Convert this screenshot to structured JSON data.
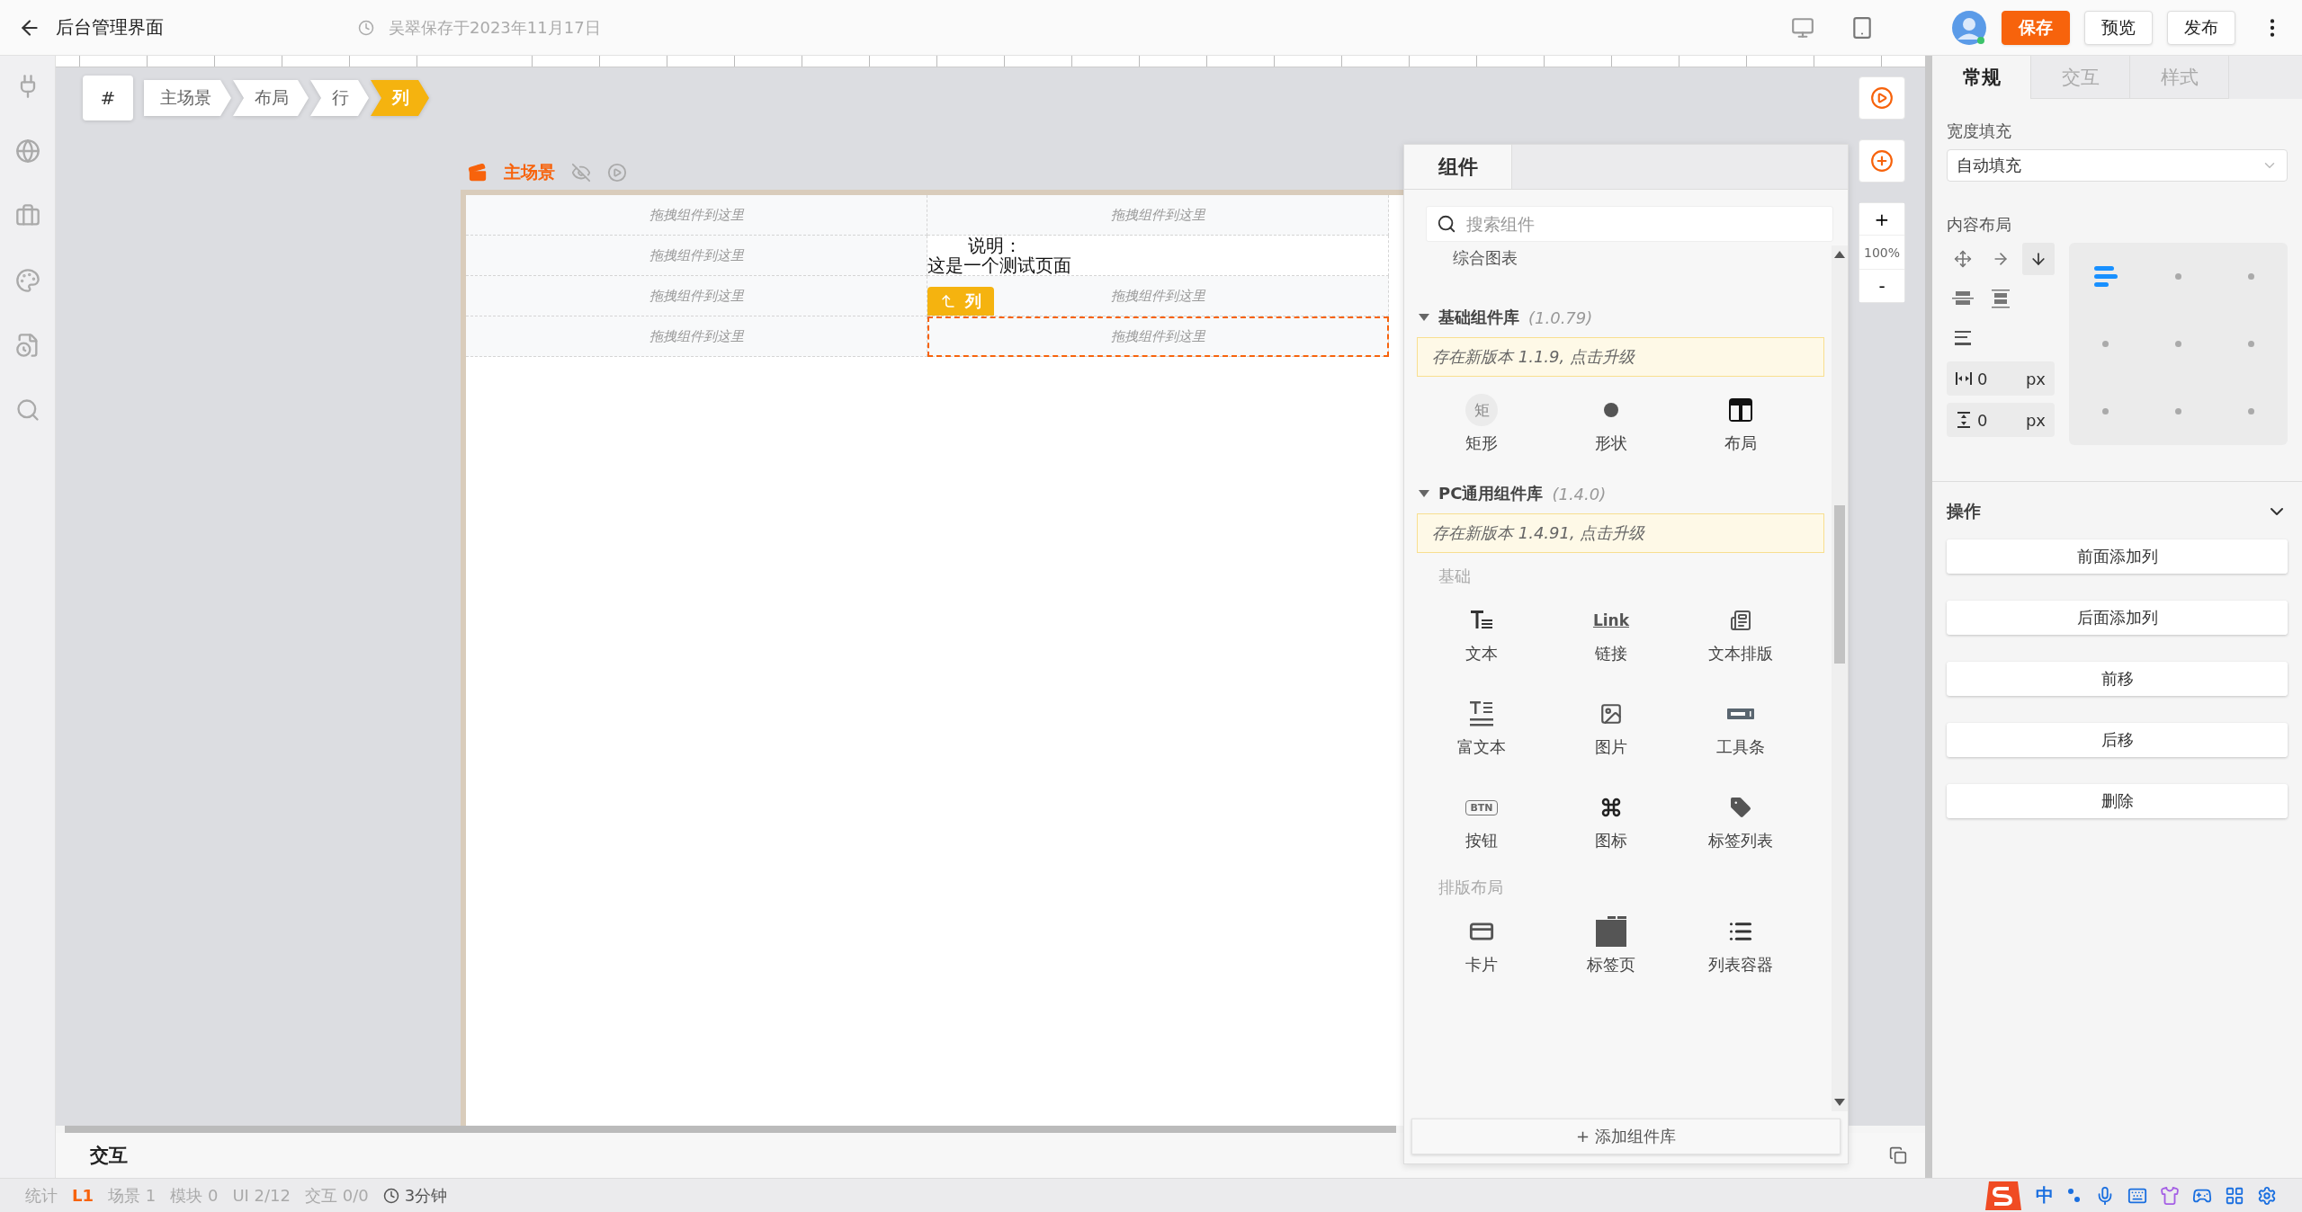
{
  "topbar": {
    "title": "后台管理界面",
    "save_status": "吴翠保存于2023年11月17日",
    "buttons": [
      {
        "label": "保存",
        "kind": "primary"
      },
      {
        "label": "预览",
        "kind": "default"
      },
      {
        "label": "发布",
        "kind": "default"
      }
    ]
  },
  "breadcrumb": {
    "root": "#",
    "items": [
      {
        "label": "主场景",
        "selected": false
      },
      {
        "label": "布局",
        "selected": false
      },
      {
        "label": "行",
        "selected": false
      },
      {
        "label": "列",
        "selected": true
      }
    ]
  },
  "scene": {
    "title": "主场景"
  },
  "page": {
    "rows": [
      {
        "cells": [
          {
            "kind": "placeholder",
            "text": "拖拽组件到这里",
            "selected": false
          },
          {
            "kind": "placeholder",
            "text": "拖拽组件到这里",
            "selected": false
          }
        ]
      },
      {
        "cells": [
          {
            "kind": "placeholder",
            "text": "拖拽组件到这里",
            "selected": false
          },
          {
            "kind": "text",
            "lines": [
              "说明：",
              "这是一个测试页面"
            ],
            "selected": false
          }
        ]
      },
      {
        "cells": [
          {
            "kind": "placeholder",
            "text": "拖拽组件到这里",
            "selected": false
          },
          {
            "kind": "placeholder",
            "text": "拖拽组件到这里",
            "selected": false
          }
        ]
      },
      {
        "cells": [
          {
            "kind": "placeholder",
            "text": "拖拽组件到这里",
            "selected": false
          },
          {
            "kind": "placeholder",
            "text": "拖拽组件到这里",
            "selected": true,
            "tag": "列"
          }
        ]
      }
    ]
  },
  "zoom": {
    "plus": "+",
    "reading": "100%",
    "minus": "-"
  },
  "components_panel": {
    "tab": "组件",
    "search_placeholder": "搜索组件",
    "cut_item": "综合图表",
    "libraries": [
      {
        "name": "基础组件库",
        "version": "(1.0.79)",
        "expanded": true,
        "notice": "存在新版本 1.1.9, 点击升级",
        "sections": [
          {
            "items": [
              {
                "label": "矩形",
                "kind": "glyph",
                "glyph": "矩"
              },
              {
                "label": "形状",
                "kind": "dot"
              },
              {
                "label": "布局",
                "kind": "layout"
              }
            ]
          }
        ]
      },
      {
        "name": "PC通用组件库",
        "version": "(1.4.0)",
        "expanded": true,
        "notice": "存在新版本 1.4.91, 点击升级",
        "sections": [
          {
            "title": "基础",
            "items": [
              {
                "label": "文本",
                "kind": "text"
              },
              {
                "label": "链接",
                "kind": "link",
                "glyph": "Link"
              },
              {
                "label": "文本排版",
                "kind": "textlayout"
              },
              {
                "label": "富文本",
                "kind": "richtext"
              },
              {
                "label": "图片",
                "kind": "image"
              },
              {
                "label": "工具条",
                "kind": "toolbar"
              },
              {
                "label": "按钮",
                "kind": "button",
                "glyph": "BTN"
              },
              {
                "label": "图标",
                "kind": "command"
              },
              {
                "label": "标签列表",
                "kind": "tag"
              }
            ]
          },
          {
            "title": "排版布局",
            "items": [
              {
                "label": "卡片",
                "kind": "card"
              },
              {
                "label": "标签页",
                "kind": "tabs"
              },
              {
                "label": "列表容器",
                "kind": "list"
              }
            ]
          }
        ]
      }
    ],
    "add_library": "+ 添加组件库"
  },
  "props_panel": {
    "tabs": [
      {
        "label": "常规",
        "selected": true
      },
      {
        "label": "交互",
        "selected": false
      },
      {
        "label": "样式",
        "selected": false
      }
    ],
    "width_fill": {
      "label": "宽度填充",
      "value": "自动填充"
    },
    "content_layout": {
      "label": "内容布局",
      "directions": [
        {
          "kind": "free",
          "selected": false
        },
        {
          "kind": "row",
          "selected": false
        },
        {
          "kind": "column",
          "selected": true
        }
      ],
      "gaps": [
        {
          "kind": "horizontal",
          "value": "0",
          "unit": "px"
        },
        {
          "kind": "vertical",
          "value": "0",
          "unit": "px"
        }
      ],
      "align": [
        {
          "selected": true
        },
        {
          "selected": false
        },
        {
          "selected": false
        },
        {
          "selected": false
        },
        {
          "selected": false
        },
        {
          "selected": false
        },
        {
          "selected": false
        },
        {
          "selected": false
        },
        {
          "selected": false
        }
      ]
    },
    "actions": {
      "title": "操作",
      "expanded": true,
      "buttons": [
        "前面添加列",
        "后面添加列",
        "前移",
        "后移",
        "删除"
      ]
    }
  },
  "bottom_panel": {
    "title": "交互"
  },
  "status_bar": {
    "items": [
      {
        "kind": "label",
        "text": "统计"
      },
      {
        "kind": "level",
        "text": "L1"
      },
      {
        "kind": "stat",
        "text": "场景 1"
      },
      {
        "kind": "stat",
        "text": "模块 0"
      },
      {
        "kind": "stat",
        "text": "UI 2/12"
      },
      {
        "kind": "stat",
        "text": "交互 0/0"
      },
      {
        "kind": "time",
        "text": "3分钟"
      }
    ]
  },
  "ime": {
    "mode": "中"
  }
}
